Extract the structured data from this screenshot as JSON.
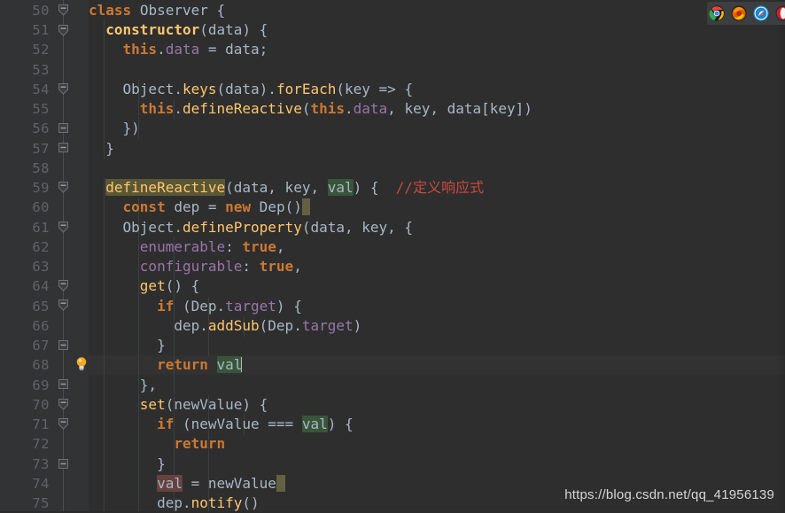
{
  "editor": {
    "theme": "darcula",
    "background": "#2e2e2e",
    "gutter_background": "#313335",
    "line_number_color": "#606366",
    "first_line": 50,
    "last_line": 75,
    "caret_line": 68,
    "colors": {
      "keyword": "#cc7832",
      "function": "#ffc66d",
      "property": "#9876aa",
      "text": "#a9b7c6",
      "comment_red": "#cc4a3f",
      "usage_highlight": "#5a5735",
      "read_highlight": "#385539",
      "write_highlight": "#66423f"
    },
    "line_numbers": [
      50,
      51,
      52,
      53,
      54,
      55,
      56,
      57,
      58,
      59,
      60,
      61,
      62,
      63,
      64,
      65,
      66,
      67,
      68,
      69,
      70,
      71,
      72,
      73,
      74,
      75
    ],
    "lines": [
      {
        "n": 50,
        "text": "class Observer {",
        "fold": "collapse"
      },
      {
        "n": 51,
        "text": "  constructor(data) {",
        "fold": "collapse"
      },
      {
        "n": 52,
        "text": "    this.data = data;",
        "fold": null
      },
      {
        "n": 53,
        "text": "",
        "fold": null
      },
      {
        "n": 54,
        "text": "    Object.keys(data).forEach(key => {",
        "fold": "collapse"
      },
      {
        "n": 55,
        "text": "      this.defineReactive(this.data, key, data[key])",
        "fold": null
      },
      {
        "n": 56,
        "text": "    })",
        "fold": "end"
      },
      {
        "n": 57,
        "text": "  }",
        "fold": "end"
      },
      {
        "n": 58,
        "text": "",
        "fold": null
      },
      {
        "n": 59,
        "text": "  defineReactive(data, key, val) {  //定义响应式",
        "fold": "collapse"
      },
      {
        "n": 60,
        "text": "    const dep = new Dep()",
        "fold": null
      },
      {
        "n": 61,
        "text": "    Object.defineProperty(data, key, {",
        "fold": "collapse"
      },
      {
        "n": 62,
        "text": "      enumerable: true,",
        "fold": null
      },
      {
        "n": 63,
        "text": "      configurable: true,",
        "fold": null
      },
      {
        "n": 64,
        "text": "      get() {",
        "fold": "collapse"
      },
      {
        "n": 65,
        "text": "        if (Dep.target) {",
        "fold": "collapse"
      },
      {
        "n": 66,
        "text": "          dep.addSub(Dep.target)",
        "fold": null
      },
      {
        "n": 67,
        "text": "        }",
        "fold": "end"
      },
      {
        "n": 68,
        "text": "        return val",
        "fold": null,
        "bulb": true
      },
      {
        "n": 69,
        "text": "      },",
        "fold": "end"
      },
      {
        "n": 70,
        "text": "      set(newValue) {",
        "fold": "collapse"
      },
      {
        "n": 71,
        "text": "        if (newValue === val) {",
        "fold": "collapse"
      },
      {
        "n": 72,
        "text": "          return",
        "fold": null
      },
      {
        "n": 73,
        "text": "        }",
        "fold": "end"
      },
      {
        "n": 74,
        "text": "        val = newValue",
        "fold": null
      },
      {
        "n": 75,
        "text": "        dep.notify()",
        "fold": null
      }
    ],
    "comment": "//定义响应式",
    "intention_bulb_line": 68,
    "caret_after": "val"
  },
  "browser_bar": {
    "icons": [
      {
        "name": "chrome-icon",
        "label": "Chrome",
        "color": "#4285f4"
      },
      {
        "name": "firefox-icon",
        "label": "Firefox",
        "color": "#e66000"
      },
      {
        "name": "safari-icon",
        "label": "Safari",
        "color": "#1b88ca"
      },
      {
        "name": "opera-icon",
        "label": "Opera",
        "color": "#cc1e2c"
      }
    ]
  },
  "watermark": {
    "text": "https://blog.csdn.net/qq_41956139"
  }
}
